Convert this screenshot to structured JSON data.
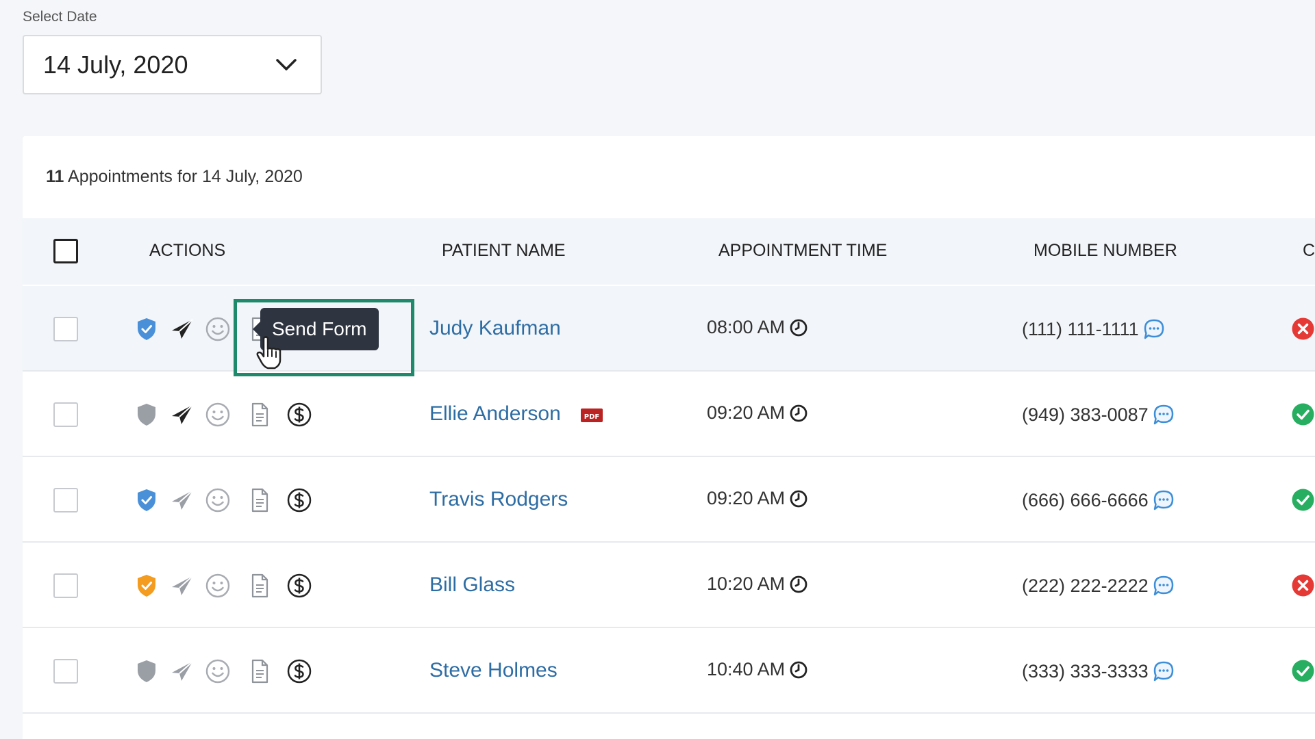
{
  "date_picker": {
    "label": "Select Date",
    "value": "14 July, 2020"
  },
  "summary": {
    "count": "11",
    "text": "Appointments for 14 July, 2020"
  },
  "table": {
    "headers": {
      "actions": "ACTIONS",
      "patient_name": "PATIENT NAME",
      "appointment_time": "APPOINTMENT TIME",
      "mobile_number": "MOBILE NUMBER",
      "next_column_partial": "C"
    },
    "rows": [
      {
        "patient_name": "Judy Kaufman",
        "time": "08:00 AM",
        "mobile": "(111) 111-1111",
        "shield": "blue",
        "send_active": true,
        "has_payment_icon": false,
        "has_pdf": false,
        "status": "error"
      },
      {
        "patient_name": "Ellie Anderson",
        "time": "09:20 AM",
        "mobile": "(949) 383-0087",
        "shield": "gray",
        "send_active": true,
        "has_payment_icon": true,
        "has_pdf": true,
        "status": "success"
      },
      {
        "patient_name": "Travis Rodgers",
        "time": "09:20 AM",
        "mobile": "(666) 666-6666",
        "shield": "blue",
        "send_active": false,
        "has_payment_icon": true,
        "has_pdf": false,
        "status": "success"
      },
      {
        "patient_name": "Bill Glass",
        "time": "10:20 AM",
        "mobile": "(222) 222-2222",
        "shield": "orange",
        "send_active": false,
        "has_payment_icon": true,
        "has_pdf": false,
        "status": "error"
      },
      {
        "patient_name": "Steve Holmes",
        "time": "10:40 AM",
        "mobile": "(333) 333-3333",
        "shield": "gray",
        "send_active": false,
        "has_payment_icon": true,
        "has_pdf": false,
        "status": "success"
      }
    ]
  },
  "tooltip": {
    "text": "Send Form"
  },
  "pdf_badge_text": "PDF",
  "icons": {
    "shield": "shield-icon",
    "send": "paper-plane-icon",
    "smile": "smiley-icon",
    "form": "document-icon",
    "payment": "dollar-icon",
    "clock": "clock-icon",
    "chat": "chat-bubble-icon",
    "status_error": "x-circle-icon",
    "status_success": "check-circle-icon",
    "cursor": "hand-cursor-icon"
  },
  "colors": {
    "link": "#2e6da4",
    "shield_blue": "#4a90d9",
    "shield_orange": "#f39c1f",
    "shield_gray": "#9a9ea5",
    "status_error": "#e53935",
    "status_success": "#27ae60",
    "highlight": "#1f8a6b",
    "tooltip_bg": "#2f3540"
  }
}
